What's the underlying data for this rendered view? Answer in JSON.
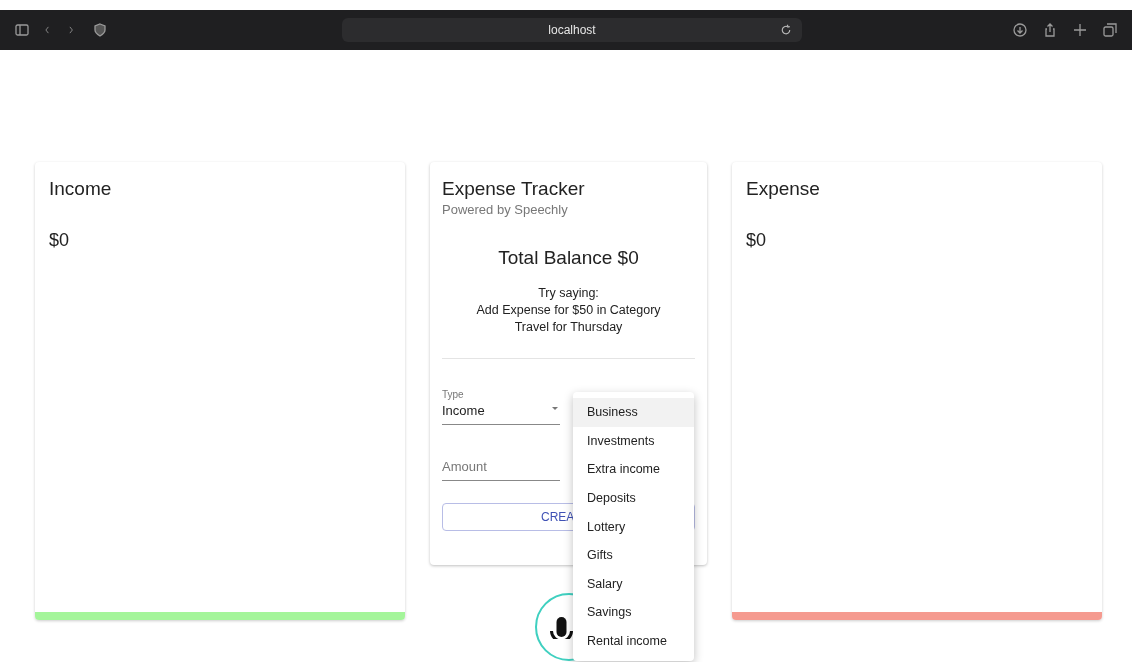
{
  "browser": {
    "address": "localhost"
  },
  "income": {
    "title": "Income",
    "amount": "$0",
    "color": "#a4f59a"
  },
  "tracker": {
    "title": "Expense Tracker",
    "subtitle": "Powered by Speechly",
    "balance": "Total Balance $0",
    "hint": [
      "Try saying:",
      "Add Expense for $50 in Category",
      "Travel for Thursday"
    ],
    "type": {
      "label": "Type",
      "value": "Income"
    },
    "amount": {
      "placeholder": "Amount"
    },
    "create_button": "CREA"
  },
  "category_menu": [
    {
      "label": "Business",
      "selected": true
    },
    {
      "label": "Investments",
      "selected": false
    },
    {
      "label": "Extra income",
      "selected": false
    },
    {
      "label": "Deposits",
      "selected": false
    },
    {
      "label": "Lottery",
      "selected": false
    },
    {
      "label": "Gifts",
      "selected": false
    },
    {
      "label": "Salary",
      "selected": false
    },
    {
      "label": "Savings",
      "selected": false
    },
    {
      "label": "Rental income",
      "selected": false
    }
  ],
  "expense": {
    "title": "Expense",
    "amount": "$0",
    "color": "#f59a8f"
  }
}
